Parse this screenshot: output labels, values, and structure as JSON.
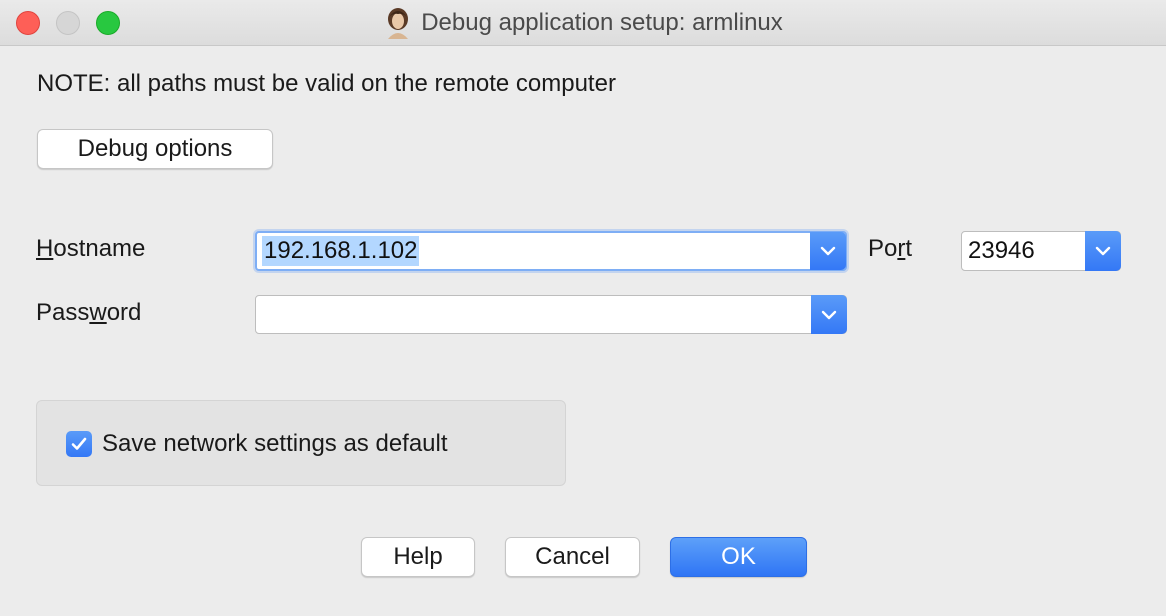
{
  "window": {
    "title": "Debug application setup: armlinux"
  },
  "note": "NOTE: all paths must be valid on the remote computer",
  "debug_options_label": "Debug options",
  "fields": {
    "hostname": {
      "label_pre": "",
      "label_ul": "H",
      "label_post": "ostname",
      "value": "192.168.1.102"
    },
    "password": {
      "label_pre": "Pass",
      "label_ul": "w",
      "label_post": "ord",
      "value": ""
    },
    "port": {
      "label_pre": "Po",
      "label_ul": "r",
      "label_post": "t",
      "value": "23946"
    }
  },
  "save_default": {
    "label": "Save network settings as default",
    "checked": true
  },
  "buttons": {
    "help": "Help",
    "cancel": "Cancel",
    "ok": "OK"
  },
  "icons": {
    "app": "app-portrait-icon",
    "dropdown": "chevron-down-icon",
    "check": "checkmark-icon"
  },
  "colors": {
    "accent": "#3478f6",
    "selection": "#b3d7ff"
  }
}
